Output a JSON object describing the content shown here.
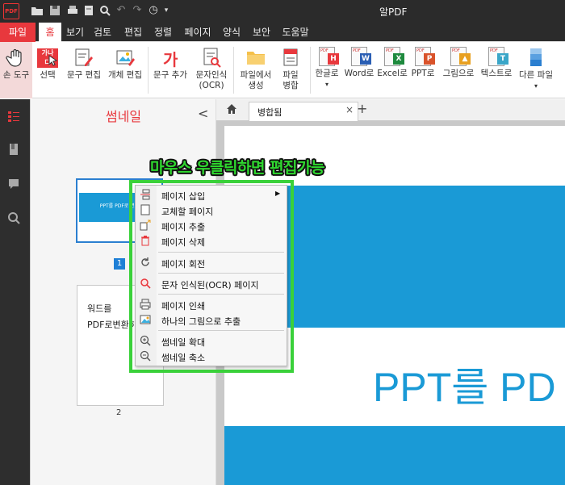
{
  "titlebar": {
    "logo": "PDF",
    "title": "알PDF",
    "quick_access_icons": [
      "open-folder-icon",
      "save-icon",
      "print-icon",
      "print-preview-icon",
      "print-setup-icon",
      "undo-icon",
      "redo-icon",
      "recent-icon"
    ]
  },
  "menubar": {
    "items": [
      "파일",
      "홈",
      "보기",
      "검토",
      "편집",
      "정렬",
      "페이지",
      "양식",
      "보안",
      "도움말"
    ],
    "active": "홈"
  },
  "ribbon": {
    "hand_tool": "손 도구",
    "select": "선택",
    "text_edit": "문구 편집",
    "object_edit": "개체 편집",
    "add_text": "문구 추가",
    "ocr_line1": "문자인식",
    "ocr_line2": "(OCR)",
    "create_from_file_line1": "파일에서",
    "create_from_file_line2": "생성",
    "merge_line1": "파일",
    "merge_line2": "병합",
    "to_hwp": "한글로",
    "to_word": "Word로",
    "to_excel": "Excel로",
    "to_ppt": "PPT로",
    "to_image": "그림으로",
    "to_text": "텍스트로",
    "other_file": "다른 파일",
    "select_icon_text": "가나다",
    "add_text_icon_text": "가",
    "hwp_tag": "H",
    "word_tag": "W",
    "excel_tag": "X",
    "ppt_tag": "P",
    "text_tag": "T"
  },
  "thumbnails": {
    "title": "썸네일",
    "page1_label": "1",
    "page1_text": "PPT를 PDF로 변환",
    "page2_line1": "워드를",
    "page2_line2": "PDF로변환하",
    "page2_label": "2"
  },
  "tabs": {
    "doc_tab": "병합됨",
    "close": "×",
    "new_tab": "+"
  },
  "document": {
    "big_text": "PPT를 PD"
  },
  "annotation": {
    "text": "마우스 우클릭하면 편집가능"
  },
  "context_menu": {
    "items": [
      {
        "label": "페이지 삽입",
        "icon": "insert-page-icon",
        "submenu": true
      },
      {
        "label": "교체할 페이지",
        "icon": "replace-page-icon"
      },
      {
        "label": "페이지 추출",
        "icon": "extract-page-icon"
      },
      {
        "label": "페이지 삭제",
        "icon": "trash-icon"
      },
      {
        "label": "페이지 회전",
        "icon": "rotate-icon"
      },
      {
        "label": "문자 인식된(OCR) 페이지",
        "icon": "ocr-icon"
      },
      {
        "label": "페이지 인쇄",
        "icon": "print-icon"
      },
      {
        "label": "하나의 그림으로 추출",
        "icon": "image-export-icon"
      },
      {
        "label": "썸네일 확대",
        "icon": "zoom-in-icon"
      },
      {
        "label": "썸네일 축소",
        "icon": "zoom-out-icon"
      }
    ],
    "submenu_arrow": "▶"
  },
  "colors": {
    "accent_red": "#e8383d",
    "dark_bar": "#2b2b2b",
    "slide_blue": "#1a9ad6",
    "highlight_green": "#3ad13a"
  }
}
